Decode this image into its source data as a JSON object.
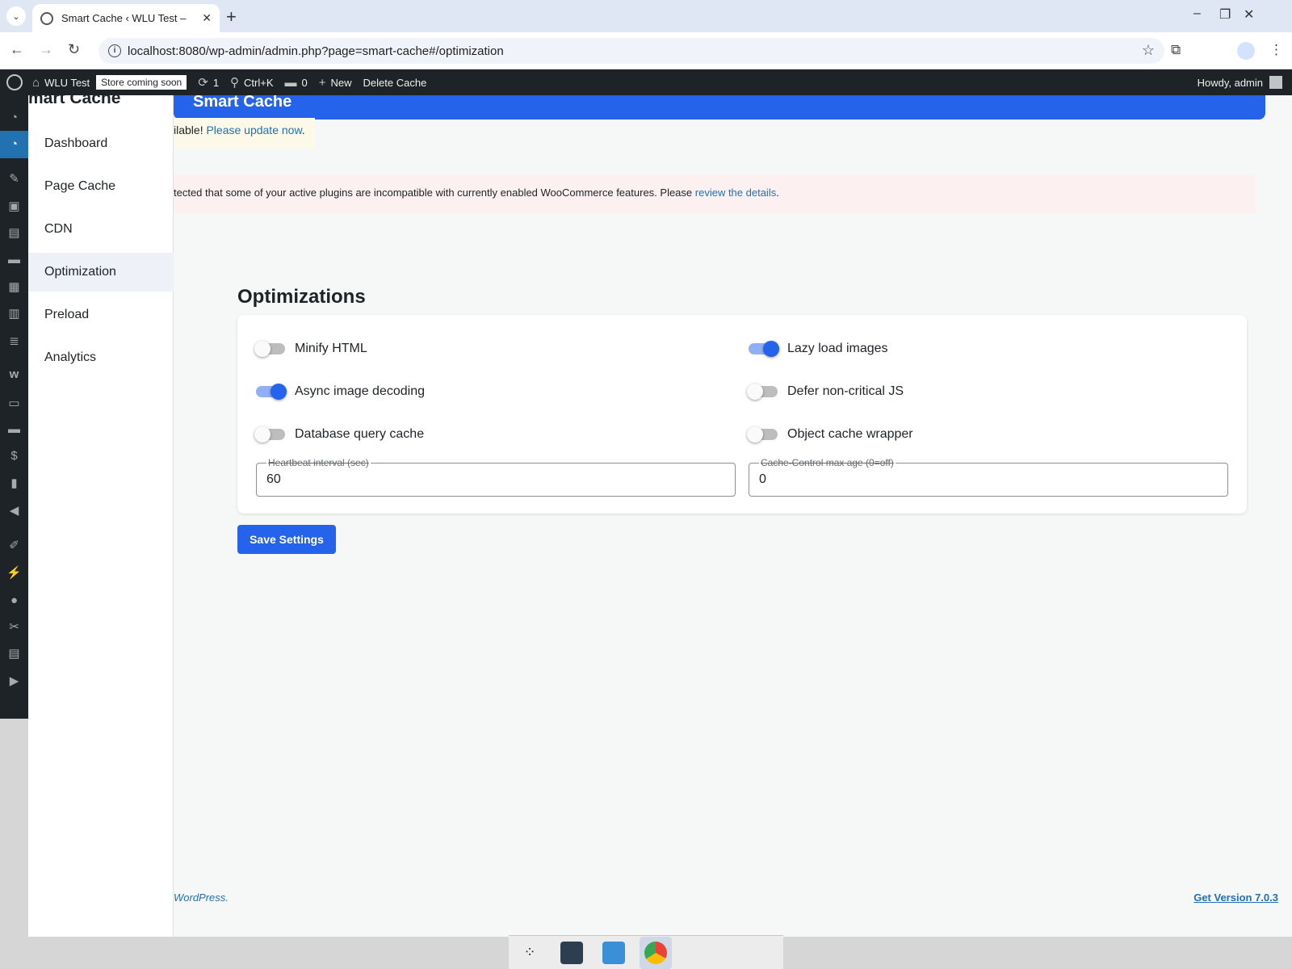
{
  "browser": {
    "tab_title": "Smart Cache ‹ WLU Test –",
    "url": "localhost:8080/wp-admin/admin.php?page=smart-cache#/optimization"
  },
  "adminbar": {
    "site_name": "WLU Test",
    "store_badge": "Store coming soon",
    "updates_count": "1",
    "search_shortcut": "Ctrl+K",
    "comments_count": "0",
    "new_label": "New",
    "delete_cache_label": "Delete Cache",
    "howdy": "Howdy, admin"
  },
  "plugin": {
    "brand": "mart Cache",
    "header_title": "Smart Cache",
    "nav": [
      {
        "label": "Dashboard"
      },
      {
        "label": "Page Cache"
      },
      {
        "label": "CDN"
      },
      {
        "label": "Optimization"
      },
      {
        "label": "Preload"
      },
      {
        "label": "Analytics"
      }
    ],
    "active_nav": "Optimization"
  },
  "notices": {
    "update_prefix": "ilable! ",
    "update_link": "Please update now",
    "update_suffix": ".",
    "woo_prefix": "tected that some of your active plugins are incompatible with currently enabled WooCommerce features. Please ",
    "woo_link": "review the details",
    "woo_suffix": "."
  },
  "optimizations": {
    "title": "Optimizations",
    "toggles": [
      {
        "label": "Minify HTML",
        "on": false
      },
      {
        "label": "Lazy load images",
        "on": true
      },
      {
        "label": "Async image decoding",
        "on": true
      },
      {
        "label": "Defer non-critical JS",
        "on": false
      },
      {
        "label": "Database query cache",
        "on": false
      },
      {
        "label": "Object cache wrapper",
        "on": false
      }
    ],
    "heartbeat": {
      "label": "Heartbeat interval (sec)",
      "value": "60"
    },
    "cache_control": {
      "label": "Cache-Control max age (0=off)",
      "value": "0"
    },
    "save_label": "Save Settings"
  },
  "footer": {
    "left": "WordPress.",
    "right": "Get Version 7.0.3"
  },
  "colors": {
    "accent": "#2563eb",
    "adminbar": "#1d2327"
  }
}
